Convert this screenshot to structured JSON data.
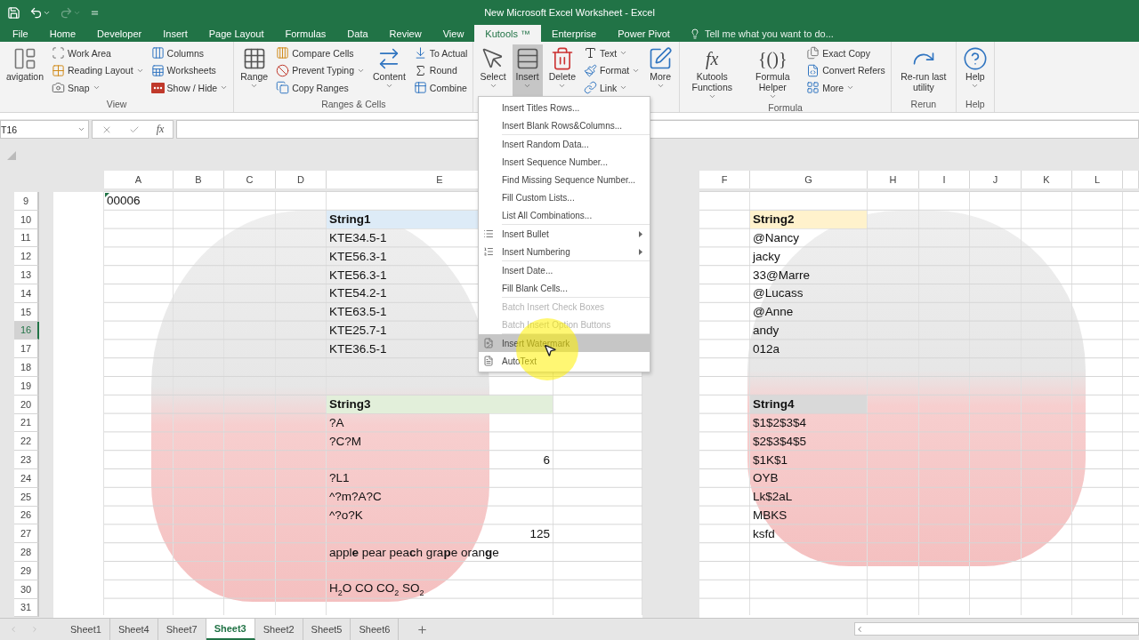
{
  "window": {
    "title": "New Microsoft Excel Worksheet - Excel",
    "redo": {
      "disabled": true
    }
  },
  "tabs": [
    {
      "label": "File",
      "selected": false
    },
    {
      "label": "Home",
      "selected": false
    },
    {
      "label": "Developer",
      "selected": false
    },
    {
      "label": "Insert",
      "selected": false
    },
    {
      "label": "Page Layout",
      "selected": false
    },
    {
      "label": "Formulas",
      "selected": false
    },
    {
      "label": "Data",
      "selected": false
    },
    {
      "label": "Review",
      "selected": false
    },
    {
      "label": "View",
      "selected": false
    },
    {
      "label": "Kutools ™",
      "selected": true
    },
    {
      "label": "Enterprise",
      "selected": false
    },
    {
      "label": "Power Pivot",
      "selected": false
    }
  ],
  "tell_me": {
    "placeholder": "Tell me what you want to do..."
  },
  "ribbon": {
    "groups": [
      {
        "label": "View",
        "columns": [
          {
            "kind": "large",
            "label": "avigation",
            "menu": false,
            "pressed": false
          },
          {
            "kind": "stack",
            "items": [
              {
                "label": "Work Area",
                "menu": false,
                "pressed": false
              },
              {
                "label": "Reading Layout",
                "menu": true,
                "pressed": false
              },
              {
                "label": "Snap",
                "menu": true,
                "pressed": false
              }
            ]
          },
          {
            "kind": "stack",
            "items": [
              {
                "label": "Columns",
                "menu": false,
                "pressed": false
              },
              {
                "label": "Worksheets",
                "menu": false,
                "pressed": false
              },
              {
                "label": "Show / Hide",
                "menu": true,
                "pressed": false
              }
            ]
          }
        ]
      },
      {
        "label": "Ranges & Cells",
        "columns": [
          {
            "kind": "large",
            "label": "Range",
            "menu": true,
            "pressed": false
          },
          {
            "kind": "stack",
            "items": [
              {
                "label": "Compare Cells",
                "menu": false,
                "pressed": false
              },
              {
                "label": "Prevent Typing",
                "menu": true,
                "pressed": false
              },
              {
                "label": "Copy Ranges",
                "menu": false,
                "pressed": false
              }
            ]
          },
          {
            "kind": "large",
            "label": "Content",
            "menu": true,
            "pressed": false
          },
          {
            "kind": "stack",
            "items": [
              {
                "label": "To Actual",
                "menu": false,
                "pressed": false
              },
              {
                "label": "Round",
                "menu": false,
                "pressed": false
              },
              {
                "label": "Combine",
                "menu": false,
                "pressed": false
              }
            ]
          }
        ]
      },
      {
        "columns": [
          {
            "kind": "large",
            "label": "Select",
            "menu": true,
            "pressed": false
          },
          {
            "kind": "large",
            "label": "Insert",
            "menu": true,
            "pressed": true
          },
          {
            "kind": "large",
            "label": "Delete",
            "menu": true,
            "pressed": false
          },
          {
            "kind": "stack",
            "items": [
              {
                "label": "Text",
                "menu": true,
                "pressed": false
              },
              {
                "label": "Format",
                "menu": true,
                "pressed": false
              },
              {
                "label": "Link",
                "menu": true,
                "pressed": false
              }
            ]
          },
          {
            "kind": "large",
            "label": "More",
            "menu": true,
            "pressed": false
          }
        ]
      },
      {
        "label": "Formula",
        "columns": [
          {
            "kind": "large",
            "label": "Kutools Functions",
            "glyph": "fx",
            "menu": true,
            "pressed": false
          },
          {
            "kind": "large",
            "label": "Formula Helper",
            "glyph": "{()}",
            "menu": true,
            "pressed": false
          },
          {
            "kind": "stack",
            "items": [
              {
                "label": "Exact Copy",
                "menu": false,
                "pressed": false
              },
              {
                "label": "Convert Refers",
                "menu": false,
                "pressed": false
              },
              {
                "label": "More",
                "menu": true,
                "pressed": false
              }
            ]
          }
        ]
      },
      {
        "label": "Rerun",
        "columns": [
          {
            "kind": "large",
            "label": "Re-run last utility",
            "menu": false,
            "pressed": false
          }
        ]
      },
      {
        "label": "Help",
        "columns": [
          {
            "kind": "large",
            "label": "Help",
            "menu": true,
            "pressed": false
          }
        ]
      }
    ]
  },
  "formula_bar": {
    "name_box": "T16",
    "function_label": "fx"
  },
  "sheet": {
    "left_columns": [
      "A",
      "B",
      "C",
      "D",
      "E"
    ],
    "right_columns": [
      "F",
      "G",
      "H",
      "I",
      "J",
      "K",
      "L"
    ],
    "row_numbers": [
      {
        "label": "9",
        "selected": false
      },
      {
        "label": "10",
        "selected": false
      },
      {
        "label": "11",
        "selected": false
      },
      {
        "label": "12",
        "selected": false
      },
      {
        "label": "13",
        "selected": false
      },
      {
        "label": "14",
        "selected": false
      },
      {
        "label": "15",
        "selected": false
      },
      {
        "label": "16",
        "selected": true
      },
      {
        "label": "17",
        "selected": false
      },
      {
        "label": "18",
        "selected": false
      },
      {
        "label": "19",
        "selected": false
      },
      {
        "label": "20",
        "selected": false
      },
      {
        "label": "21",
        "selected": false
      },
      {
        "label": "22",
        "selected": false
      },
      {
        "label": "23",
        "selected": false
      },
      {
        "label": "24",
        "selected": false
      },
      {
        "label": "25",
        "selected": false
      },
      {
        "label": "26",
        "selected": false
      },
      {
        "label": "27",
        "selected": false
      },
      {
        "label": "28",
        "selected": false
      },
      {
        "label": "29",
        "selected": false
      },
      {
        "label": "30",
        "selected": false
      },
      {
        "label": "31",
        "selected": false
      }
    ],
    "cell_a9": {
      "text": "00006",
      "flagged": true
    },
    "left_tables": [
      {
        "header": "String1",
        "color": "#ddebf7",
        "items": [
          {
            "kind": "text",
            "text": "KTE34.5-1"
          },
          {
            "kind": "text",
            "text": "KTE56.3-1"
          },
          {
            "kind": "text",
            "text": "KTE56.3-1"
          },
          {
            "kind": "text",
            "text": "KTE54.2-1"
          },
          {
            "kind": "text",
            "text": "KTE63.5-1"
          },
          {
            "kind": "text",
            "text": "KTE25.7-1"
          },
          {
            "kind": "text",
            "text": "KTE36.5-1"
          }
        ]
      },
      {
        "header": "String3",
        "color": "#e2efda",
        "items": [
          {
            "kind": "text",
            "text": "?A"
          },
          {
            "kind": "text",
            "text": "?C?M"
          },
          {
            "kind": "number",
            "text": "6"
          },
          {
            "kind": "text",
            "text": "?L1"
          },
          {
            "kind": "text",
            "text": "^?m?A?C"
          },
          {
            "kind": "text",
            "text": "^?o?K"
          },
          {
            "kind": "number",
            "text": "125"
          },
          {
            "kind": "text",
            "text": "appl**e** pear pea**c**h gra**p**e oran**g**e"
          },
          {
            "kind": "blank"
          },
          {
            "kind": "text",
            "text": "H$_{2}$O CO CO$_{2}$ SO$_{2}$"
          }
        ]
      }
    ],
    "right_tables": [
      {
        "header": "String2",
        "color": "#fff2cc",
        "items": [
          {
            "kind": "text",
            "text": "@Nancy"
          },
          {
            "kind": "text",
            "text": "jacky"
          },
          {
            "kind": "text",
            "text": "33@Marre"
          },
          {
            "kind": "text",
            "text": "@Lucass"
          },
          {
            "kind": "text",
            "text": "@Anne"
          },
          {
            "kind": "text",
            "text": "andy"
          },
          {
            "kind": "text",
            "text": "012a"
          }
        ]
      },
      {
        "header": "String4",
        "color": "#d9d9d9",
        "items": [
          {
            "kind": "text",
            "text": "$1$2$3$4"
          },
          {
            "kind": "text",
            "text": "$2$3$4$5"
          },
          {
            "kind": "text",
            "text": "$1K$1"
          },
          {
            "kind": "text",
            "text": "OYB"
          },
          {
            "kind": "text",
            "text": "Lk$2aL"
          },
          {
            "kind": "text",
            "text": "MBKS"
          },
          {
            "kind": "text",
            "text": "ksfd"
          }
        ]
      }
    ]
  },
  "insert_menu": {
    "groups": [
      [
        {
          "label": "Insert Titles Rows...",
          "kind": "plain",
          "disabled": false,
          "selected": false,
          "submenu": false
        },
        {
          "label": "Insert Blank Rows&Columns...",
          "kind": "plain",
          "disabled": false,
          "selected": false,
          "submenu": false
        }
      ],
      [
        {
          "label": "Insert Random Data...",
          "kind": "plain",
          "disabled": false,
          "selected": false,
          "submenu": false
        },
        {
          "label": "Insert Sequence Number...",
          "kind": "plain",
          "disabled": false,
          "selected": false,
          "submenu": false
        },
        {
          "label": "Find Missing Sequence Number...",
          "kind": "plain",
          "disabled": false,
          "selected": false,
          "submenu": false
        },
        {
          "label": "Fill Custom Lists...",
          "kind": "plain",
          "disabled": false,
          "selected": false,
          "submenu": false
        },
        {
          "label": "List All Combinations...",
          "kind": "plain",
          "disabled": false,
          "selected": false,
          "submenu": false
        }
      ],
      [
        {
          "label": "Insert Bullet",
          "kind": "bullets",
          "disabled": false,
          "selected": false,
          "submenu": true
        },
        {
          "label": "Insert Numbering",
          "kind": "numbering",
          "disabled": false,
          "selected": false,
          "submenu": true
        }
      ],
      [
        {
          "label": "Insert Date...",
          "kind": "plain",
          "disabled": false,
          "selected": false,
          "submenu": false
        },
        {
          "label": "Fill Blank Cells...",
          "kind": "plain",
          "disabled": false,
          "selected": false,
          "submenu": false
        }
      ],
      [
        {
          "label": "Batch Insert Check Boxes",
          "kind": "plain",
          "disabled": true,
          "selected": false,
          "submenu": false
        },
        {
          "label": "Batch Insert Option Buttons",
          "kind": "plain",
          "disabled": true,
          "selected": false,
          "submenu": false
        }
      ],
      [
        {
          "label": "Insert Watermark",
          "kind": "watermark",
          "disabled": false,
          "selected": true,
          "submenu": false
        },
        {
          "label": "AutoText",
          "kind": "autotext",
          "disabled": false,
          "selected": false,
          "submenu": false
        }
      ]
    ]
  },
  "sheet_tabs": [
    {
      "label": "Sheet1",
      "selected": false
    },
    {
      "label": "Sheet4",
      "selected": false
    },
    {
      "label": "Sheet7",
      "selected": false
    },
    {
      "label": "Sheet3",
      "selected": true
    },
    {
      "label": "Sheet2",
      "selected": false
    },
    {
      "label": "Sheet5",
      "selected": false
    },
    {
      "label": "Sheet6",
      "selected": false
    }
  ]
}
